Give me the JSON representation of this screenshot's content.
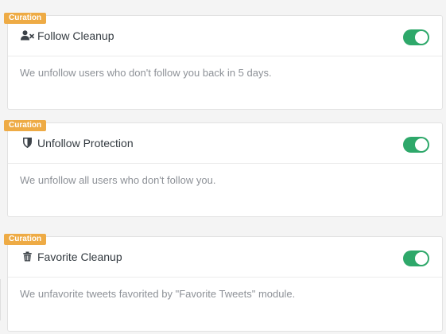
{
  "badge_label": "Curation",
  "colors": {
    "badge": "#eeab45",
    "toggle_on": "#2ea86a",
    "title_text": "#333a40",
    "desc_text": "#8d9197"
  },
  "modules": [
    {
      "icon": "user-times-icon",
      "title": "Follow Cleanup",
      "description": "We unfollow users who don't follow you back in 5 days.",
      "enabled": true
    },
    {
      "icon": "shield-icon",
      "title": "Unfollow Protection",
      "description": "We unfollow all users who don't follow you.",
      "enabled": true
    },
    {
      "icon": "trash-icon",
      "title": "Favorite Cleanup",
      "description": "We unfavorite tweets favorited by \"Favorite Tweets\" module.",
      "enabled": true
    }
  ]
}
